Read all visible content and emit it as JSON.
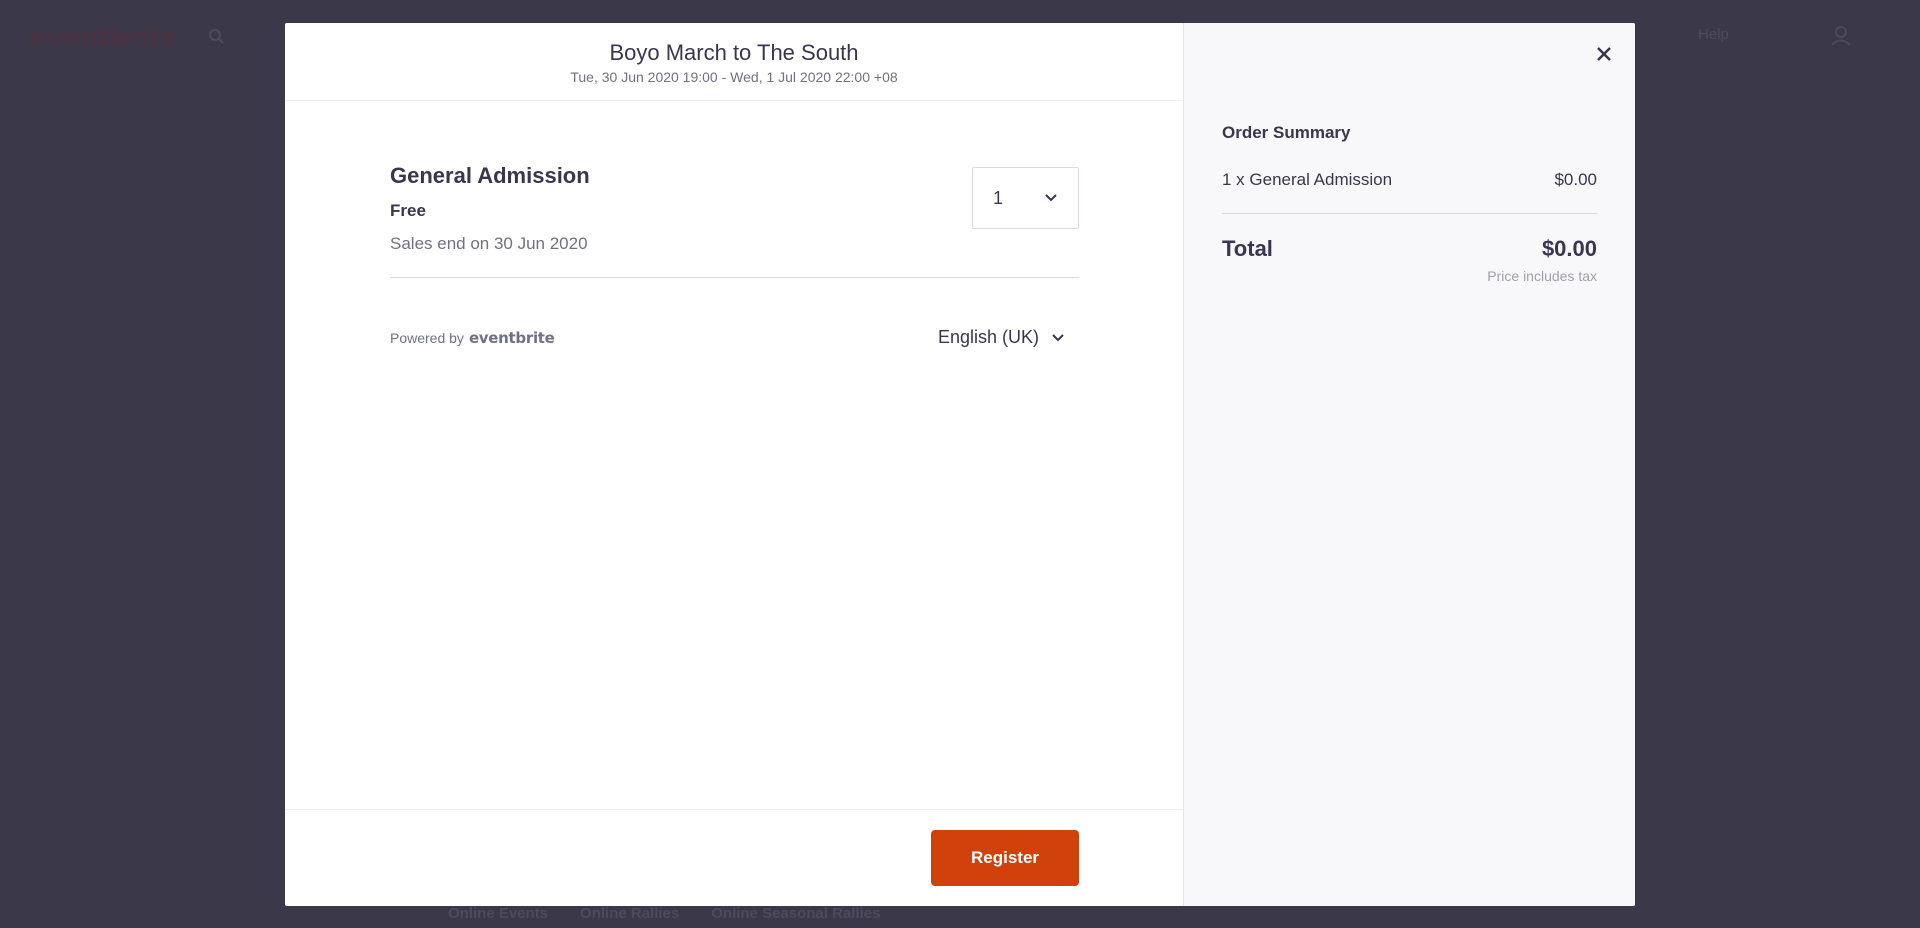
{
  "background": {
    "logo": "eventbrite",
    "help": "Help",
    "tabs": [
      "Online Events",
      "Online Rallies",
      "Online Seasonal Rallies"
    ]
  },
  "event": {
    "title": "Boyo March to The South",
    "date": "Tue, 30 Jun 2020 19:00 - Wed, 1 Jul 2020 22:00 +08"
  },
  "ticket": {
    "name": "General Admission",
    "price": "Free",
    "sales_end": "Sales end on 30 Jun 2020",
    "quantity": "1"
  },
  "footer": {
    "powered_by": "Powered by",
    "brand": "eventbrite",
    "language": "English (UK)",
    "register_label": "Register"
  },
  "summary": {
    "title": "Order Summary",
    "line_item": "1 x General Admission",
    "line_price": "$0.00",
    "total_label": "Total",
    "total_value": "$0.00",
    "tax_note": "Price includes tax"
  },
  "colors": {
    "accent": "#d1410c",
    "overlay": "#3a3849",
    "sidebar_bg": "#f8f7fa"
  },
  "icons": {
    "close": "close-icon",
    "quantity_dropdown": "chevron-down-icon",
    "language_dropdown": "chevron-down-icon"
  }
}
